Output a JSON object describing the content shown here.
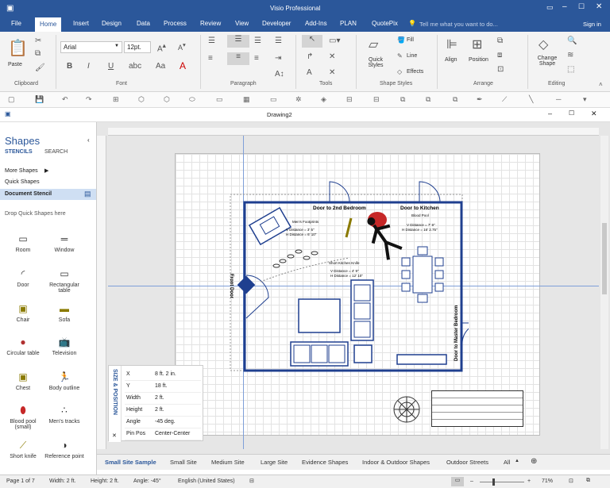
{
  "app": {
    "title": "Visio Professional",
    "signin": "Sign in",
    "tell_me": "Tell me what you want to do..."
  },
  "tabs": [
    "File",
    "Home",
    "Insert",
    "Design",
    "Data",
    "Process",
    "Review",
    "View",
    "Developer",
    "Add-Ins",
    "PLAN",
    "QuotePix"
  ],
  "ribbon": {
    "paste": "Paste",
    "font_name": "Arial",
    "font_size": "12pt.",
    "quick_styles": "Quick Styles",
    "fill": "Fill",
    "line": "Line",
    "effects": "Effects",
    "align": "Align",
    "position": "Position",
    "change_shape": "Change Shape",
    "groups": [
      "Clipboard",
      "Font",
      "Paragraph",
      "Tools",
      "Shape Styles",
      "Arrange",
      "Editing"
    ]
  },
  "document": {
    "title": "Drawing2"
  },
  "shapes_panel": {
    "title": "Shapes",
    "stencils": "STENCILS",
    "search": "SEARCH",
    "more_shapes": "More Shapes",
    "quick_shapes": "Quick Shapes",
    "document_stencil": "Document Stencil",
    "drop_hint": "Drop Quick Shapes here",
    "items": [
      "Room",
      "Window",
      "Door",
      "Rectangular table",
      "Chair",
      "Sofa",
      "Circular table",
      "Television",
      "Chest",
      "Body outline",
      "Blood pool (small)",
      "Men's tracks",
      "Short knife",
      "Reference point"
    ]
  },
  "drawing": {
    "door_bedroom2": "Door to 2nd Bedroom",
    "door_kitchen": "Door to Kitchen",
    "front_door": "Front Door",
    "door_master": "Door to Master Bedroom",
    "mens_footprints": "Men's Footprints",
    "footprints_v": "V Distance = 3' 5\"",
    "footprints_h": "H Distance = 6' 10\"",
    "blood_pool": "Blood Pool",
    "blood_v": "V Distance = 7' 9\"",
    "blood_h": "H Distance = 16' 2.75\"",
    "knife": "Short Kitchen Knife",
    "knife_v": "V Distance = 4' 9\"",
    "knife_h": "H Distance = 12' 10\""
  },
  "size_position": {
    "label": "SIZE & POSITION",
    "rows": [
      {
        "k": "X",
        "v": "8 ft. 2 in."
      },
      {
        "k": "Y",
        "v": "18 ft."
      },
      {
        "k": "Width",
        "v": "2 ft."
      },
      {
        "k": "Height",
        "v": "2 ft."
      },
      {
        "k": "Angle",
        "v": "-45 deg."
      },
      {
        "k": "Pin Pos",
        "v": "Center-Center"
      }
    ]
  },
  "page_tabs": [
    "Small Site Sample",
    "Small Site",
    "Medium Site",
    "Large Site",
    "Evidence Shapes",
    "Indoor & Outdoor Shapes",
    "Outdoor Streets",
    "All"
  ],
  "status": {
    "page": "Page 1 of 7",
    "width": "Width: 2 ft.",
    "height": "Height: 2 ft.",
    "angle": "Angle: -45°",
    "lang": "English (United States)",
    "zoom": "71%"
  },
  "colors": {
    "accent": "#2b579a",
    "room_line": "#1f3f8f",
    "blood": "#c62828"
  }
}
